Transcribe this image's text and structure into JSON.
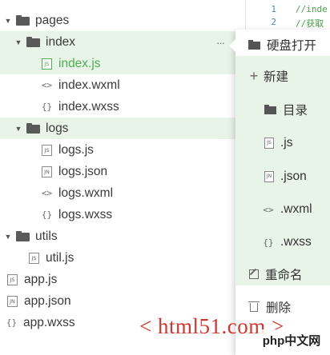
{
  "explorer": {
    "items": [
      {
        "label": "pages",
        "type": "folder",
        "expanded": true
      },
      {
        "label": "index",
        "type": "folder",
        "expanded": true,
        "selected": true
      },
      {
        "label": "index.js",
        "type": "file",
        "icon": "JS",
        "active": true
      },
      {
        "label": "index.wxml",
        "type": "file",
        "icon": "<>"
      },
      {
        "label": "index.wxss",
        "type": "file",
        "icon": "{}"
      },
      {
        "label": "logs",
        "type": "folder",
        "expanded": true
      },
      {
        "label": "logs.js",
        "type": "file",
        "icon": "JS"
      },
      {
        "label": "logs.json",
        "type": "file",
        "icon": "JN"
      },
      {
        "label": "logs.wxml",
        "type": "file",
        "icon": "<>"
      },
      {
        "label": "logs.wxss",
        "type": "file",
        "icon": "{}"
      },
      {
        "label": "utils",
        "type": "folder",
        "expanded": true
      },
      {
        "label": "util.js",
        "type": "file",
        "icon": "JS"
      },
      {
        "label": "app.js",
        "type": "file",
        "icon": "JS"
      },
      {
        "label": "app.json",
        "type": "file",
        "icon": "JN"
      },
      {
        "label": "app.wxss",
        "type": "file",
        "icon": "{}"
      }
    ],
    "more_label": "···"
  },
  "editor": {
    "lines": [
      {
        "num": "1",
        "text": "//inde"
      },
      {
        "num": "2",
        "text": "//获取"
      }
    ]
  },
  "context_menu": {
    "open_in_disk": "硬盘打开",
    "new": "新建",
    "new_items": {
      "folder": "目录",
      "js": ".js",
      "json": ".json",
      "wxml": ".wxml",
      "wxss": ".wxss"
    },
    "rename": "重命名",
    "delete": "删除"
  },
  "icons": {
    "js": "JS",
    "json": "JN",
    "wxml": "<>",
    "wxss": "{}"
  },
  "watermark": {
    "site": "< html51.com >",
    "badge": "php中文网"
  },
  "colors": {
    "accent": "#4caf50",
    "selection_bg": "#e9f4e9",
    "watermark": "#d8342c"
  }
}
